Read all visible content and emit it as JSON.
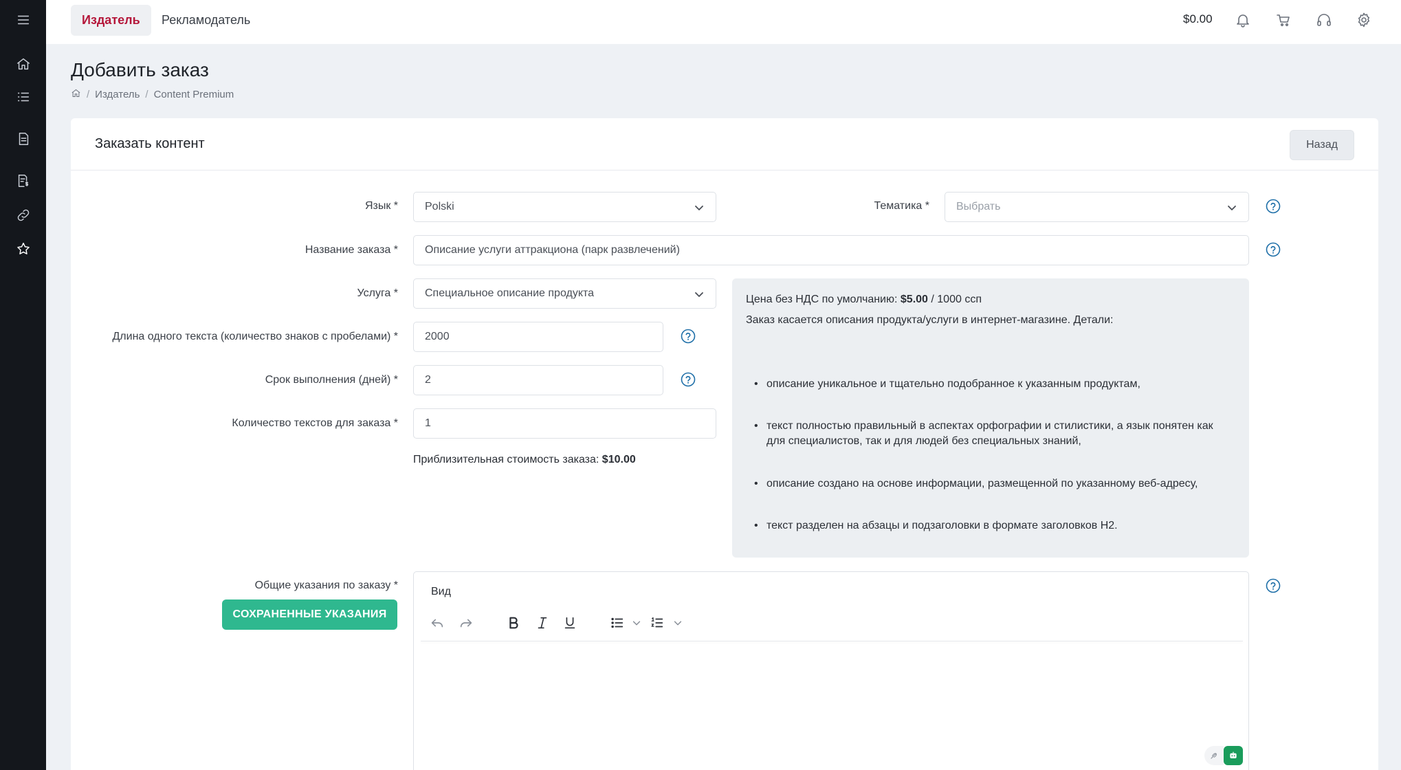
{
  "topbar": {
    "tabs": [
      {
        "label": "Издатель",
        "active": true
      },
      {
        "label": "Рекламодатель",
        "active": false
      }
    ],
    "balance": "$0.00",
    "icons": [
      "bell-icon",
      "cart-icon",
      "headset-icon",
      "gear-icon"
    ]
  },
  "sidebar": {
    "icons": [
      "menu-icon",
      "home-icon",
      "list-icon",
      "document-icon",
      "invoice-icon",
      "link-icon",
      "star-icon"
    ]
  },
  "page": {
    "title": "Добавить заказ",
    "breadcrumb": [
      "Издатель",
      "Content Premium"
    ]
  },
  "card": {
    "title": "Заказать контент",
    "back_label": "Назад"
  },
  "form": {
    "language_label": "Язык *",
    "language_value": "Polski",
    "topic_label": "Тематика *",
    "topic_placeholder": "Выбрать",
    "name_label": "Название заказа *",
    "name_value": "Описание услуги аттракциона (парк развлечений)",
    "service_label": "Услуга *",
    "service_value": "Специальное описание продукта",
    "length_label": "Длина одного текста (количество знаков с пробелами) *",
    "length_value": "2000",
    "deadline_label": "Срок выполнения (дней) *",
    "deadline_value": "2",
    "count_label": "Количество текстов для заказа *",
    "count_value": "1",
    "estimate_label": "Приблизительная стоимость заказа:",
    "estimate_value": "$10.00",
    "instructions_label": "Общие указания по заказу *",
    "saved_button": "СОХРАНЕННЫЕ УКАЗАНИЯ"
  },
  "info": {
    "price_label": "Цена без НДС по умолчанию:",
    "price_value": "$5.00",
    "price_unit": "/ 1000 ссп",
    "intro": "Заказ касается описания продукта/услуги в интернет-магазине. Детали:",
    "bullets": [
      "описание уникальное и тщательно подобранное к указанным продуктам,",
      "текст полностью правильный в аспектах орфографии и стилистики, а язык понятен как для специалистов, так и для людей без специальных знаний,",
      "описание создано на основе информации, размещенной по указанному веб-адресу,",
      "текст разделен на абзацы и подзаголовки в формате заголовков H2."
    ]
  },
  "editor": {
    "menu_label": "Вид"
  },
  "colors": {
    "accent": "#b5173a",
    "saved_button": "#2fb88f",
    "help_icon": "#1e6fa8",
    "sidebar": "#14171c"
  }
}
